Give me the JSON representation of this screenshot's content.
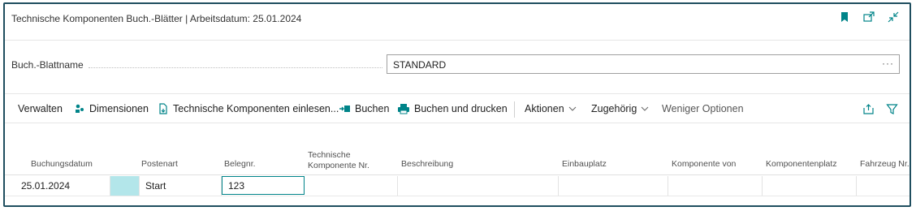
{
  "page": {
    "title": "Technische Komponenten Buch.-Blätter | Arbeitsdatum: 25.01.2024",
    "icons": [
      "bookmark-icon",
      "open-new-window-icon",
      "collapse-icon"
    ]
  },
  "journal": {
    "label": "Buch.-Blattname",
    "value": "STANDARD",
    "more": "···"
  },
  "actions": {
    "manage": "Verwalten",
    "dimensions": "Dimensionen",
    "import": "Technische Komponenten einlesen...",
    "post": "Buchen",
    "post_print": "Buchen und drucken",
    "actions": "Aktionen",
    "related": "Zugehörig",
    "fewer": "Weniger Optionen",
    "right_icons": [
      "share-icon",
      "filter-icon"
    ]
  },
  "colors": {
    "accent": "#008489",
    "frame": "#1f4e5f",
    "selected_cell": "#b3e6ea"
  },
  "grid": {
    "columns": [
      "Buchungsdatum",
      "Postenart",
      "Belegnr.",
      "Technische",
      "Komponente Nr.",
      "Beschreibung",
      "Einbauplatz",
      "Komponente von",
      "Komponentenplatz",
      "Fahrzeug Nr."
    ],
    "rows": [
      {
        "date": "25.01.2024",
        "type": "Start",
        "doc": "123"
      }
    ]
  }
}
